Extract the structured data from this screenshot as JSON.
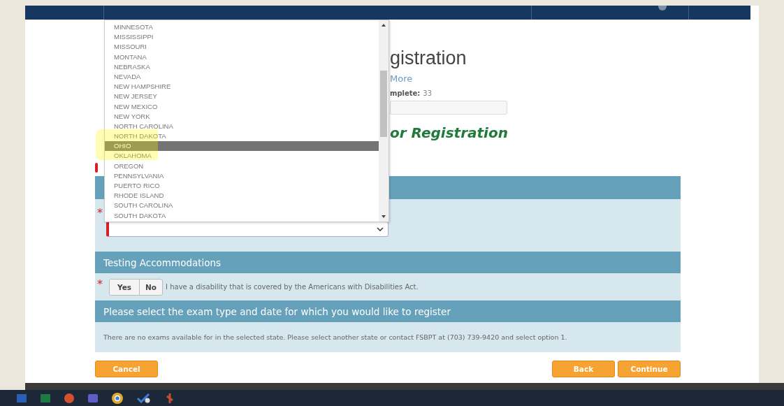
{
  "header": {
    "title": "gistration",
    "link": "More",
    "progress_label": "mplete:",
    "progress_value": "33",
    "progress": {
      "level": 0
    }
  },
  "section_title": "or Registration",
  "state_list": {
    "options": [
      {
        "label": "MINNESOTA",
        "selected": false
      },
      {
        "label": "MISSISSIPPI",
        "selected": false
      },
      {
        "label": "MISSOURI",
        "selected": false
      },
      {
        "label": "MONTANA",
        "selected": false
      },
      {
        "label": "NEBRASKA",
        "selected": false
      },
      {
        "label": "NEVADA",
        "selected": false
      },
      {
        "label": "NEW HAMPSHIRE",
        "selected": false
      },
      {
        "label": "NEW JERSEY",
        "selected": false
      },
      {
        "label": "NEW MEXICO",
        "selected": false
      },
      {
        "label": "NEW YORK",
        "selected": false
      },
      {
        "label": "NORTH CAROLINA",
        "selected": false
      },
      {
        "label": "NORTH DAKOTA",
        "selected": false
      },
      {
        "label": "OHIO",
        "selected": true
      },
      {
        "label": "OKLAHOMA",
        "selected": false
      },
      {
        "label": "OREGON",
        "selected": false
      },
      {
        "label": "PENNSYLVANIA",
        "selected": false
      },
      {
        "label": "PUERTO RICO",
        "selected": false
      },
      {
        "label": "RHODE ISLAND",
        "selected": false
      },
      {
        "label": "SOUTH CAROLINA",
        "selected": false
      },
      {
        "label": "SOUTH DAKOTA",
        "selected": false
      }
    ]
  },
  "state_field": {
    "required": true,
    "required_mark": "*"
  },
  "accommodations": {
    "heading": "Testing Accommodations",
    "required": true,
    "required_mark": "*",
    "options": [
      {
        "label": "Yes",
        "selected": false
      },
      {
        "label": "No",
        "selected": false
      }
    ],
    "statement": "I have a disability that is covered by the Americans with Disabilities Act."
  },
  "exam": {
    "heading": "Please select the exam type and date for which you would like to register",
    "message": "There are no exams available for in the selected state. Please select another state or contact FSBPT at (703) 739-9420 and select option 1."
  },
  "buttons": [
    {
      "label": "Cancel",
      "kind": "left"
    },
    {
      "label": "Back",
      "kind": "right"
    },
    {
      "label": "Continue",
      "kind": "right"
    }
  ]
}
